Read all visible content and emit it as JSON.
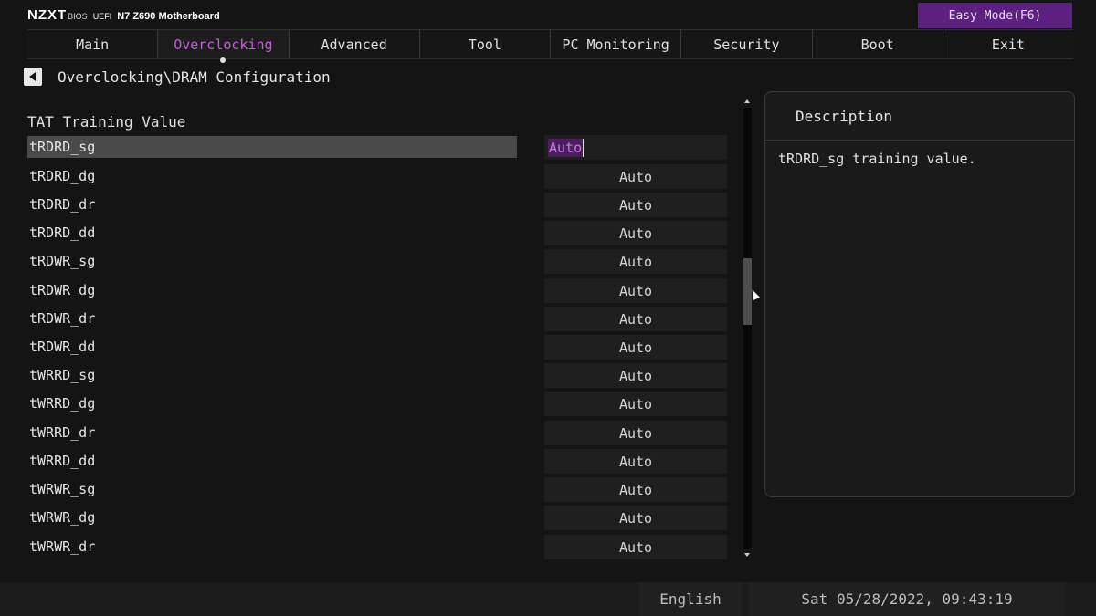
{
  "brand": {
    "logo": "NZXT",
    "bios": "BIOS",
    "uefi": "UEFI",
    "model": "N7 Z690 Motherboard"
  },
  "easy_mode_label": "Easy Mode(F6)",
  "nav": {
    "tabs": [
      {
        "label": "Main"
      },
      {
        "label": "Overclocking"
      },
      {
        "label": "Advanced"
      },
      {
        "label": "Tool"
      },
      {
        "label": "PC Monitoring"
      },
      {
        "label": "Security"
      },
      {
        "label": "Boot"
      },
      {
        "label": "Exit"
      }
    ],
    "active": "Overclocking",
    "active_color": "#c35fd6"
  },
  "breadcrumb": "Overclocking\\DRAM Configuration",
  "section_title": "TAT Training Value",
  "settings": [
    {
      "label": "tRDRD_sg",
      "value": "Auto"
    },
    {
      "label": "tRDRD_dg",
      "value": "Auto"
    },
    {
      "label": "tRDRD_dr",
      "value": "Auto"
    },
    {
      "label": "tRDRD_dd",
      "value": "Auto"
    },
    {
      "label": "tRDWR_sg",
      "value": "Auto"
    },
    {
      "label": "tRDWR_dg",
      "value": "Auto"
    },
    {
      "label": "tRDWR_dr",
      "value": "Auto"
    },
    {
      "label": "tRDWR_dd",
      "value": "Auto"
    },
    {
      "label": "tWRRD_sg",
      "value": "Auto"
    },
    {
      "label": "tWRRD_dg",
      "value": "Auto"
    },
    {
      "label": "tWRRD_dr",
      "value": "Auto"
    },
    {
      "label": "tWRRD_dd",
      "value": "Auto"
    },
    {
      "label": "tWRWR_sg",
      "value": "Auto"
    },
    {
      "label": "tWRWR_dg",
      "value": "Auto"
    },
    {
      "label": "tWRWR_dr",
      "value": "Auto"
    }
  ],
  "selected_index": 0,
  "description": {
    "title": "Description",
    "text": "tRDRD_sg training value."
  },
  "status": {
    "language": "English",
    "datetime": "Sat 05/28/2022, 09:43:19"
  },
  "icons": {
    "back": "back-arrow-icon",
    "scroll_up": "scroll-up-arrow-icon",
    "scroll_down": "scroll-down-arrow-icon",
    "cursor": "mouse-pointer-icon"
  },
  "colors": {
    "accent": "#c35fd6",
    "easy_mode_bg": "#5d1f80",
    "selected_row": "#4a4a4a"
  }
}
